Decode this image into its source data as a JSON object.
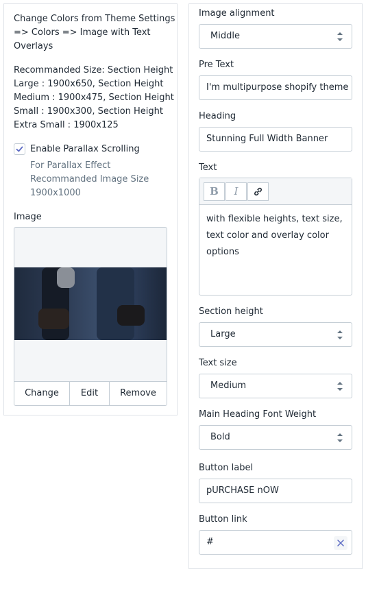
{
  "left_panel": {
    "info_lines": [
      "Change Colors from Theme Settings",
      "=> Colors => Image with Text",
      "Overlays"
    ],
    "size_lines": [
      "Recommanded Size: Section Height",
      "Large : 1900x650, Section Height",
      "Medium : 1900x475, Section Height",
      "Small : 1900x300, Section Height",
      "Extra Small : 1900x125"
    ],
    "parallax": {
      "label": "Enable Parallax Scrolling",
      "checked": true,
      "help_lines": [
        "For Parallax Effect",
        "Recommanded Image Size",
        "1900x1000"
      ]
    },
    "image": {
      "label": "Image",
      "actions": [
        "Change",
        "Edit",
        "Remove"
      ]
    }
  },
  "right_panel": {
    "image_alignment": {
      "label": "Image alignment",
      "value": "Middle"
    },
    "pre_text": {
      "label": "Pre Text",
      "value": "I'm multipurpose shopify theme"
    },
    "heading": {
      "label": "Heading",
      "value": "Stunning Full Width Banner"
    },
    "text": {
      "label": "Text",
      "toolbar": {
        "bold": "B",
        "italic": "I"
      },
      "lines": [
        "with flexible heights, text size,",
        "text color and overlay color",
        "options"
      ]
    },
    "section_height": {
      "label": "Section height",
      "value": "Large"
    },
    "text_size": {
      "label": "Text size",
      "value": "Medium"
    },
    "heading_weight": {
      "label": "Main Heading Font Weight",
      "value": "Bold"
    },
    "button_label": {
      "label": "Button label",
      "value": "pURCHASE nOW"
    },
    "button_link": {
      "label": "Button link",
      "value": "#"
    }
  },
  "colors": {
    "accent": "#5c6ac4",
    "border": "#c4cdd5",
    "text": "#212b36",
    "muted": "#637381"
  }
}
